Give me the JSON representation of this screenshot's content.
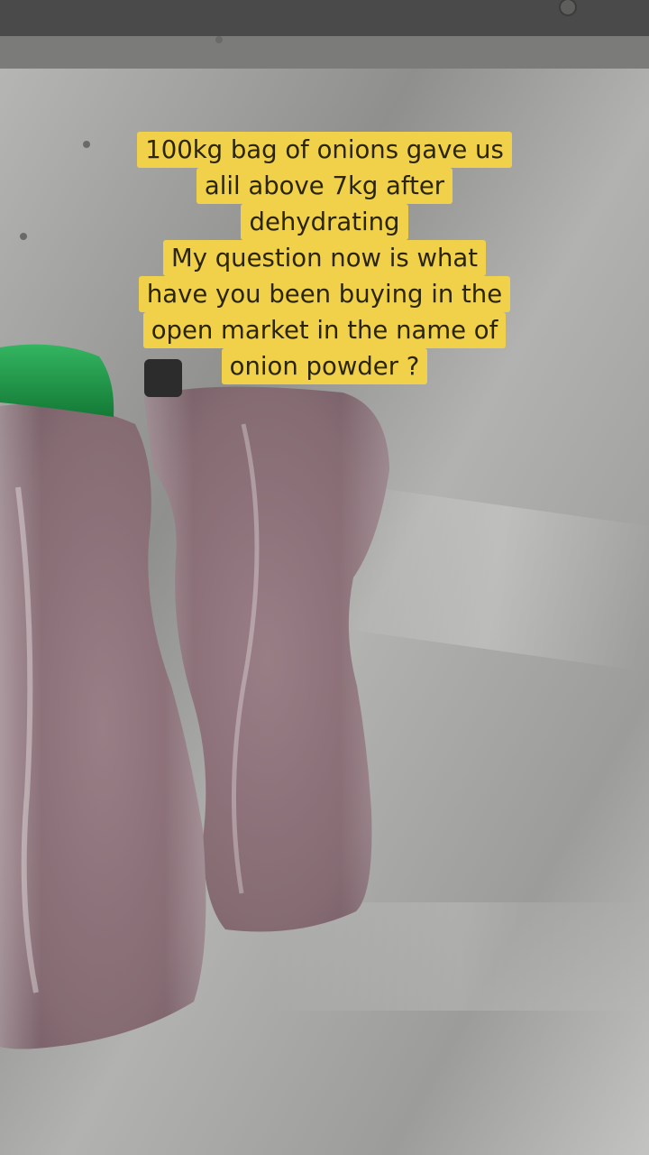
{
  "caption": {
    "lines": [
      "100kg bag of onions gave us",
      "alil above 7kg after",
      "dehydrating",
      "My question now is what",
      "have you been buying in the",
      "open market in the name of",
      "onion powder ?"
    ]
  },
  "colors": {
    "caption_background": "#f2d14a",
    "caption_text": "#2b2508",
    "steel": "#a7a7a5",
    "powder": "#8a6a72",
    "lid": "#1e9a48"
  }
}
